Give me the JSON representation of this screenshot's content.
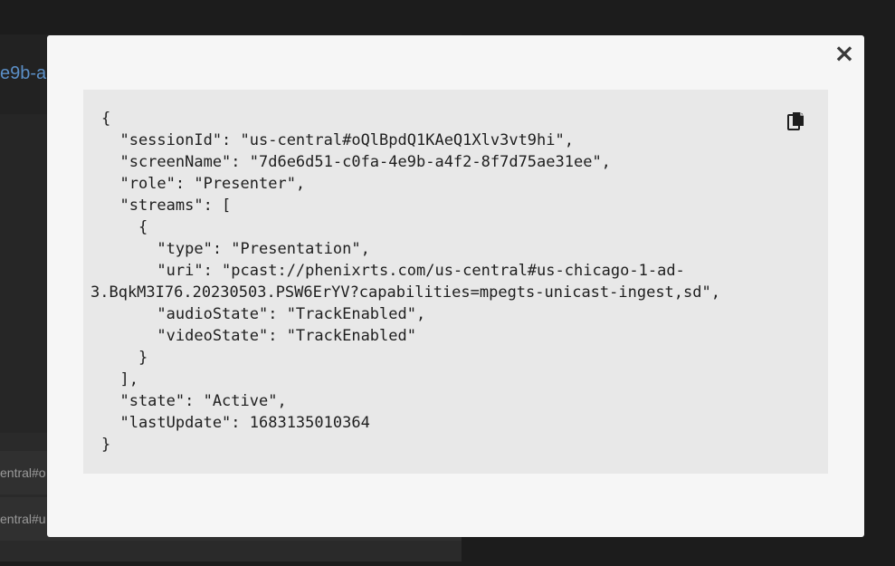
{
  "background": {
    "header_fragment": "e9b-a",
    "rows": [
      "entral#o",
      "entral#u"
    ]
  },
  "modal": {
    "close_glyph": "×",
    "copy_icon": "copy-icon",
    "json_lines": [
      "{",
      "  \"sessionId\": \"us-central#oQlBpdQ1KAeQ1Xlv3vt9hi\",",
      "  \"screenName\": \"7d6e6d51-c0fa-4e9b-a4f2-8f7d75ae31ee\",",
      "  \"role\": \"Presenter\",",
      "  \"streams\": [",
      "    {",
      "      \"type\": \"Presentation\",",
      "      \"uri\": \"pcast://phenixrts.com/us-central#us-chicago-1-ad-",
      "3.BqkM3I76.20230503.PSW6ErYV?capabilities=mpegts-unicast-ingest,sd\",",
      "      \"audioState\": \"TrackEnabled\",",
      "      \"videoState\": \"TrackEnabled\"",
      "    }",
      "  ],",
      "  \"state\": \"Active\",",
      "  \"lastUpdate\": 1683135010364",
      "}"
    ]
  },
  "colors": {
    "modal_bg": "#f6f6f6",
    "code_bg": "#e8e8e8",
    "link_blue": "#5b8fc7"
  }
}
